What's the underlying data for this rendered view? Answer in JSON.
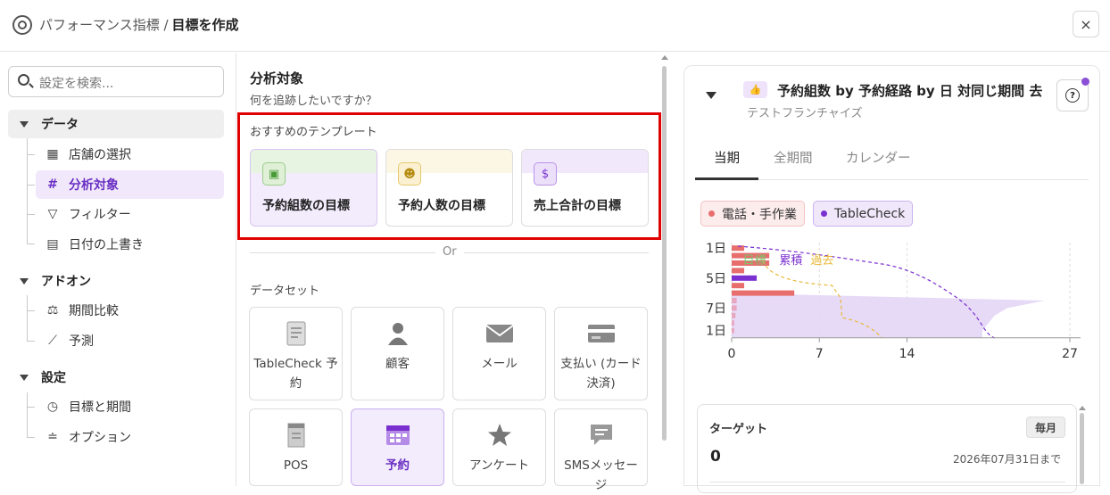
{
  "header": {
    "breadcrumb_parent": "パフォーマンス指標 /",
    "breadcrumb_current": "目標を作成",
    "close_icon": "×"
  },
  "sidebar": {
    "search_placeholder": "設定を検索...",
    "sections": [
      {
        "label": "データ",
        "items": [
          {
            "label": "店舗の選択",
            "icon": "store-icon"
          },
          {
            "label": "分析対象",
            "icon": "hash-icon",
            "active": true
          },
          {
            "label": "フィルター",
            "icon": "filter-icon"
          },
          {
            "label": "日付の上書き",
            "icon": "calendar-icon"
          }
        ]
      },
      {
        "label": "アドオン",
        "items": [
          {
            "label": "期間比較",
            "icon": "scale-icon"
          },
          {
            "label": "予測",
            "icon": "trend-icon"
          }
        ]
      },
      {
        "label": "設定",
        "items": [
          {
            "label": "目標と期間",
            "icon": "calendar-clock-icon"
          },
          {
            "label": "オプション",
            "icon": "sliders-icon"
          }
        ]
      }
    ]
  },
  "main": {
    "title": "分析対象",
    "subtitle": "何を追跡したいですか？",
    "templates_label": "おすすめのテンプレート",
    "templates": [
      {
        "label": "予約組数の目標",
        "icon": "calendar-icon",
        "accent": "#e6f4e1"
      },
      {
        "label": "予約人数の目標",
        "icon": "people-icon",
        "accent": "#fcf7e4"
      },
      {
        "label": "売上合計の目標",
        "icon": "people-money-icon",
        "accent": "#f1e8fb"
      }
    ],
    "or_label": "Or",
    "datasets_label": "データセット",
    "datasets": [
      {
        "label": "TableCheck 予約",
        "icon": "document-icon"
      },
      {
        "label": "顧客",
        "icon": "person-icon"
      },
      {
        "label": "メール",
        "icon": "mail-icon"
      },
      {
        "label": "支払い (カード決済)",
        "icon": "card-icon"
      },
      {
        "label": "POS",
        "icon": "receipt-icon"
      },
      {
        "label": "予約",
        "icon": "calendar-grid-icon",
        "selected": true
      },
      {
        "label": "アンケート",
        "icon": "star-icon"
      },
      {
        "label": "SMSメッセージ",
        "icon": "chat-icon"
      }
    ]
  },
  "preview": {
    "badge_icon": "thumb-icon",
    "title": "予約組数 by 予約経路 by 日 対同じ期間 去",
    "subtitle": "テストフランチャイズ",
    "help_icon": "?",
    "tabs": [
      "当期",
      "全期間",
      "カレンダー"
    ],
    "active_tab": 0,
    "legend_chips": [
      {
        "label": "電話・手作業",
        "color": "#e86d6d"
      },
      {
        "label": "TableCheck",
        "color": "#7a2fd0"
      }
    ],
    "target_card": {
      "label": "ターゲット",
      "badge": "毎月",
      "value": "0",
      "date": "2026年07月31日まで"
    }
  },
  "chart_data": {
    "type": "bar",
    "orientation": "horizontal",
    "y_tick_labels": [
      "1日",
      "5日",
      "7日",
      "1日"
    ],
    "x_ticks": [
      0,
      7,
      14,
      27
    ],
    "xlim": [
      0,
      27
    ],
    "overlay_labels": [
      {
        "text": "目標",
        "color": "#7cc36c"
      },
      {
        "text": "累積",
        "color": "#7a2fd0"
      },
      {
        "text": "過去",
        "color": "#e9b93a"
      }
    ],
    "series": [
      {
        "name": "電話・手作業",
        "values": [
          1,
          3,
          3,
          1,
          0,
          1,
          5,
          0.4,
          0.4,
          0.3,
          0.2,
          0.2
        ]
      },
      {
        "name": "TableCheck",
        "values": [
          0,
          0,
          0,
          0,
          2,
          0,
          0,
          0,
          0,
          0,
          0,
          0
        ]
      }
    ],
    "cumulative_area": [
      0,
      0,
      0,
      0,
      0,
      0,
      0,
      25,
      22,
      21,
      20.5,
      20
    ],
    "gridlines": true
  }
}
